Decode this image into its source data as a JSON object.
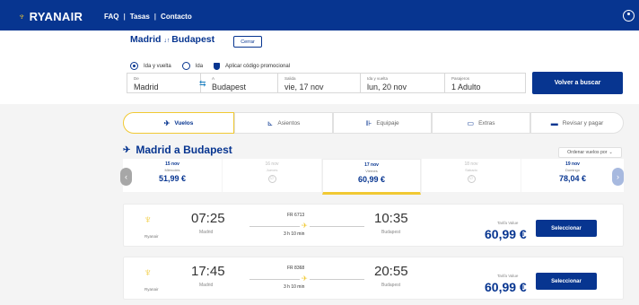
{
  "header": {
    "brand": "RYANAIR",
    "nav": [
      "FAQ",
      "Tasas",
      "Contacto"
    ]
  },
  "summary": {
    "origin": "Madrid",
    "destination": "Budapest",
    "close_label": "Cerrar",
    "trip_roundtrip": "Ida y vuelta",
    "trip_oneway": "Ida",
    "promo_label": "Aplicar código promocional",
    "fields": {
      "from_label": "De",
      "from_value": "Madrid",
      "to_label": "A",
      "to_value": "Budapest",
      "depart_label": "Salida",
      "depart_value": "vie, 17 nov",
      "return_label": "Ida y vuelta",
      "return_value": "lun, 20 nov",
      "pax_label": "Pasajeros",
      "pax_value": "1 Adulto"
    },
    "search_again": "Volver a buscar"
  },
  "steps": [
    "Vuelos",
    "Asientos",
    "Equipaje",
    "Extras",
    "Revisar y pagar"
  ],
  "results": {
    "heading": "Madrid a Budapest",
    "sort_label": "Ordenar vuelos por",
    "dates": [
      {
        "date": "15 nov",
        "weekday": "Miércoles",
        "price": "51,99 €"
      },
      {
        "date": "16 nov",
        "weekday": "Jueves",
        "price": ""
      },
      {
        "date": "17 nov",
        "weekday": "Viernes",
        "price": "60,99 €"
      },
      {
        "date": "18 nov",
        "weekday": "Sábado",
        "price": ""
      },
      {
        "date": "19 nov",
        "weekday": "Domingo",
        "price": "78,04 €"
      }
    ],
    "flights": [
      {
        "airline": "Ryanair",
        "dep_time": "07:25",
        "dep_city": "Madrid",
        "flight_no": "FR 6713",
        "duration": "3 h 10 min",
        "arr_time": "10:35",
        "arr_city": "Budapest",
        "fare": "Tarifa Value",
        "price": "60,99 €",
        "select": "Seleccionar"
      },
      {
        "airline": "Ryanair",
        "dep_time": "17:45",
        "dep_city": "Madrid",
        "flight_no": "FR 8368",
        "duration": "3 h 10 min",
        "arr_time": "20:55",
        "arr_city": "Budapest",
        "fare": "Tarifa Value",
        "price": "60,99 €",
        "select": "Seleccionar"
      }
    ]
  },
  "colors": {
    "brand_blue": "#073590",
    "accent_yellow": "#f1c933"
  }
}
